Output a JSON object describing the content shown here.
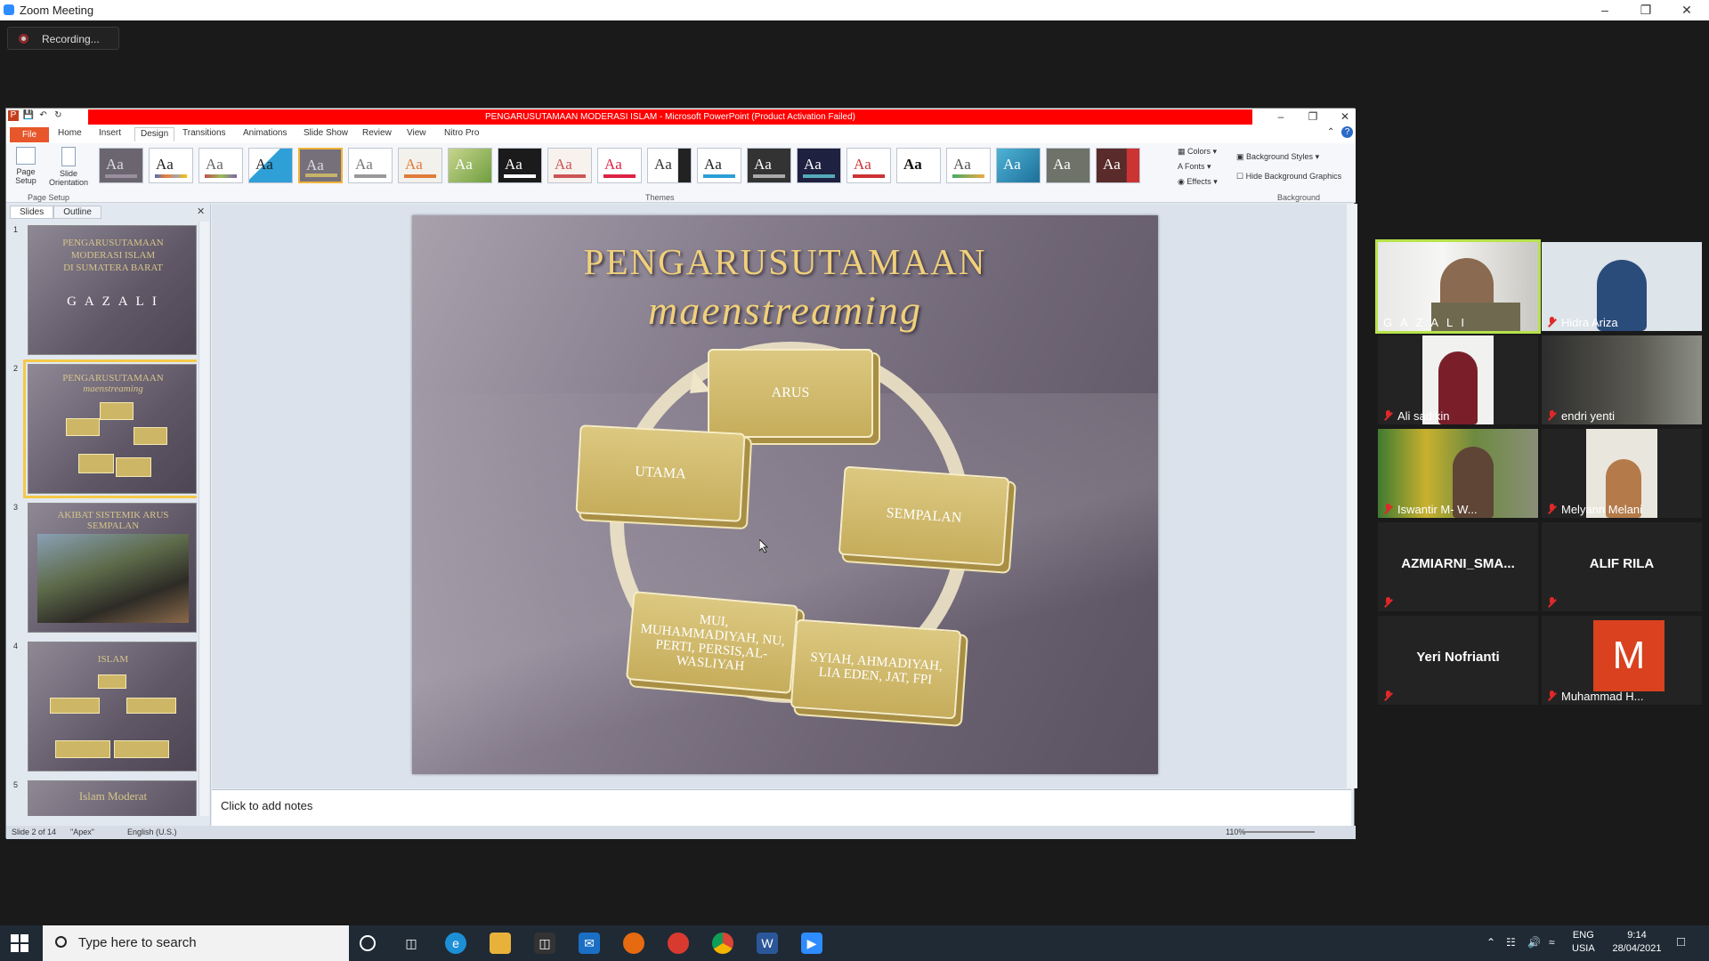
{
  "window": {
    "title": "Zoom Meeting",
    "recording": "Recording..."
  },
  "ppt": {
    "title": "PENGARUSUTAMAAN MODERASI ISLAM - Microsoft PowerPoint (Product Activation Failed)",
    "tabs": [
      "File",
      "Home",
      "Insert",
      "Design",
      "Transitions",
      "Animations",
      "Slide Show",
      "Review",
      "View",
      "Nitro Pro"
    ],
    "ribbon": {
      "page_setup": "Page Setup",
      "slide_orientation": "Slide Orientation",
      "group_page_setup": "Page Setup",
      "group_themes": "Themes",
      "group_background": "Background",
      "colors": "Colors",
      "fonts": "Fonts",
      "effects": "Effects",
      "background_styles": "Background Styles",
      "hide_bg": "Hide Background Graphics",
      "theme_glyph": "Aa"
    },
    "panel": {
      "tab_slides": "Slides",
      "tab_outline": "Outline"
    },
    "thumbs": {
      "t1a": "PENGARUSUTAMAAN",
      "t1b": "MODERASI ISLAM",
      "t1c": "DI SUMATERA BARAT",
      "t1d": "G A Z A L I",
      "t2a": "PENGARUSUTAMAAN",
      "t2b": "maenstreaming",
      "t3a": "AKIBAT SISTEMIK ARUS",
      "t3b": "SEMPALAN",
      "t4a": "ISLAM",
      "t5a": "Islam Moderat",
      "nums": [
        "1",
        "2",
        "3",
        "4",
        "5"
      ]
    },
    "slide": {
      "title": "PENGARUSUTAMAAN",
      "subtitle": "maenstreaming",
      "boxes": {
        "arus": "ARUS",
        "utama": "UTAMA",
        "sempalan": "SEMPALAN",
        "mui": "MUI, MUHAMMADIYAH, NU, PERTI, PERSIS,AL-WASLIYAH",
        "syiah": "SYIAH, AHMADIYAH, LIA EDEN, JAT, FPI"
      }
    },
    "notes": "Click to add notes",
    "status": {
      "slide": "Slide 2 of 14",
      "theme": "\"Apex\"",
      "lang": "English (U.S.)",
      "zoom": "110%"
    }
  },
  "participants": [
    {
      "name": "G A Z A L I"
    },
    {
      "name": "Hidra Ariza"
    },
    {
      "name": "Ali sadikin"
    },
    {
      "name": "endri yenti"
    },
    {
      "name": "Iswantir M- W..."
    },
    {
      "name": "Melyann Melani"
    },
    {
      "name": "AZMIARNI_SMA..."
    },
    {
      "name": "ALIF RILA"
    },
    {
      "name": "Yeri Nofrianti"
    },
    {
      "name": "Muhammad H...",
      "initial": "M"
    }
  ],
  "taskbar": {
    "search_placeholder": "Type here to search",
    "lang1": "ENG",
    "lang2": "USIA",
    "time": "9:14",
    "date": "28/04/2021"
  }
}
